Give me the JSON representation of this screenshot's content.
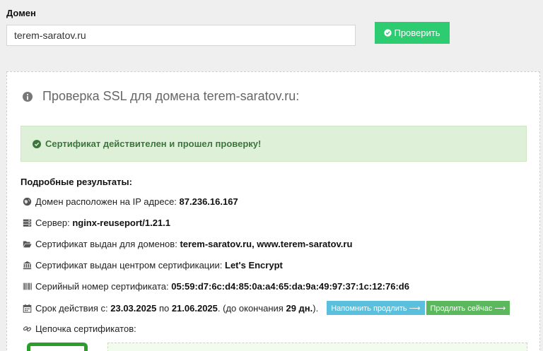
{
  "form": {
    "domain_label": "Домен",
    "domain_value": "terem-saratov.ru",
    "check_button": "Проверить"
  },
  "result": {
    "title": "Проверка SSL для домена terem-saratov.ru:",
    "alert": "Сертификат действителен и прошел проверку!",
    "details_heading": "Подробные результаты:",
    "ip_label": "Домен расположен на IP адресе: ",
    "ip_value": "87.236.16.167",
    "server_label": "Сервер: ",
    "server_value": "nginx-reuseport/1.21.1",
    "domains_label": "Сертификат выдан для доменов: ",
    "domains_value": "terem-saratov.ru, www.terem-saratov.ru",
    "issuer_label": "Сертификат выдан центром сертификации: ",
    "issuer_value": "Let's Encrypt",
    "serial_label": "Серийный номер сертификата: ",
    "serial_value": "05:59:d7:6c:d4:85:0a:a4:65:da:9a:49:97:37:1c:12:76:d6",
    "validity_label": "Срок действия с: ",
    "validity_from": "23.03.2025",
    "validity_to_word": " по ",
    "validity_to": "21.06.2025",
    "validity_remaining_prefix": ". (до окончания ",
    "validity_remaining": "29 дн.",
    "validity_remaining_suffix": ").",
    "remind_button": "Напомнить продлить ⟶",
    "renew_button": "Продлить сейчас ⟶",
    "chain_label": "Цепочка сертификатов:"
  },
  "colors": {
    "accent_green": "#2ecc71",
    "alert_bg": "#dff0d8",
    "alert_text": "#3c763d",
    "info_button": "#5bc0de",
    "success_button": "#5cb85c"
  },
  "icons": [
    "check-circle-icon",
    "info-circle-icon",
    "globe-icon",
    "server-icon",
    "folder-open-icon",
    "bank-icon",
    "barcode-icon",
    "calendar-icon",
    "link-icon"
  ]
}
